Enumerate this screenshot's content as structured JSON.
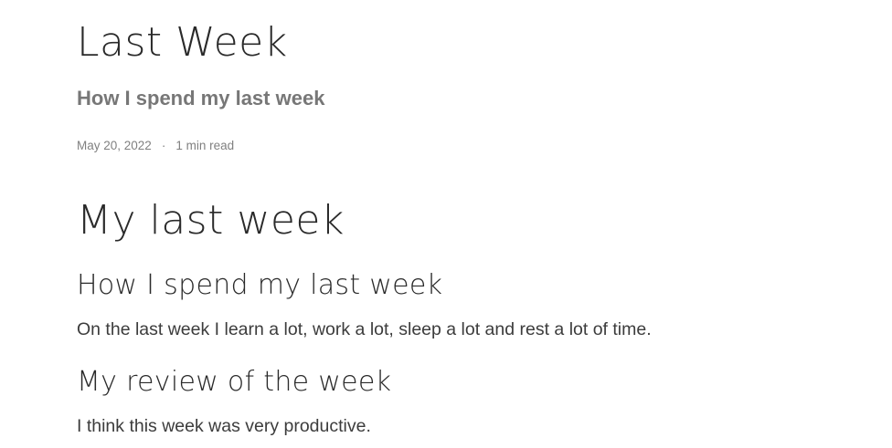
{
  "post": {
    "title": "Last Week",
    "subtitle": "How I spend my last week",
    "meta": {
      "date": "May 20, 2022",
      "separator": "·",
      "read_time": "1 min read"
    }
  },
  "content": {
    "heading": "My last week",
    "sections": [
      {
        "heading": "How I spend my last week",
        "text": "On the last week I learn a lot, work a lot, sleep a lot and rest a lot of time."
      },
      {
        "heading": "My review of the week",
        "text": "I think this week was very productive."
      }
    ]
  }
}
